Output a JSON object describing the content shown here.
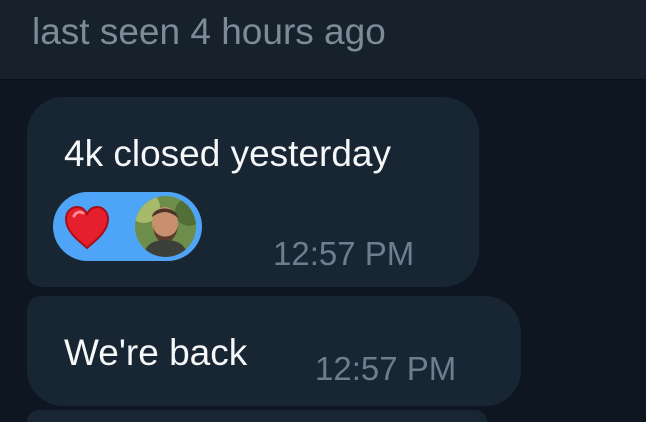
{
  "header": {
    "status_text": "last seen 4 hours ago"
  },
  "messages": [
    {
      "text": "4k closed yesterday",
      "time": "12:57 PM",
      "reaction": {
        "emoji_icon": "heart-icon",
        "count_display": "avatar"
      }
    },
    {
      "text": "We're back",
      "time": "12:57 PM"
    }
  ],
  "colors": {
    "background": "#0e1621",
    "header": "#17212b",
    "bubble": "#182533",
    "reaction": "#4ea4f6",
    "text": "#f5f7f9",
    "muted": "#7d8b99"
  }
}
